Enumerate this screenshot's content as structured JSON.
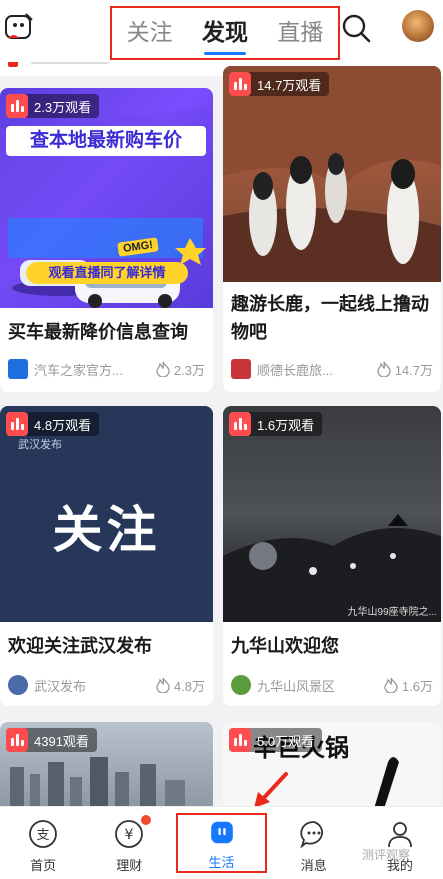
{
  "header": {
    "tabs": [
      {
        "label": "关注",
        "active": false
      },
      {
        "label": "发现",
        "active": true
      },
      {
        "label": "直播",
        "active": false
      }
    ]
  },
  "cards": [
    {
      "views": "2.3万观看",
      "title": "买车最新降价信息查询",
      "source": "汽车之家官方...",
      "likes": "2.3万",
      "banner_title": "查本地最新购车价",
      "banner_cta": "观看直播同了解详情",
      "banner_badge": "OMG!"
    },
    {
      "views": "14.7万观看",
      "title": "趣游长鹿，一起线上撸动物吧",
      "source": "顺德长鹿旅...",
      "likes": "14.7万"
    },
    {
      "views": "4.8万观看",
      "title": "欢迎关注武汉发布",
      "source": "武汉发布",
      "likes": "4.8万",
      "thumb_text": "关注",
      "thumb_sub": "武汉发布"
    },
    {
      "views": "1.6万观看",
      "title": "九华山欢迎您",
      "source": "九华山风景区",
      "likes": "1.6万",
      "thumb_caption": "九华山99座寺院之..."
    },
    {
      "views": "4391观看"
    },
    {
      "views": "5.0万观看",
      "thumb_brand": "辛巨火锅"
    }
  ],
  "tabbar": [
    {
      "label": "首页",
      "icon": "home-icon",
      "active": false
    },
    {
      "label": "理财",
      "icon": "yuan-icon",
      "active": false,
      "badge": true
    },
    {
      "label": "生活",
      "icon": "life-icon",
      "active": true
    },
    {
      "label": "消息",
      "icon": "message-icon",
      "active": false
    },
    {
      "label": "我的",
      "icon": "profile-icon",
      "active": false
    }
  ],
  "watermark": "测评观察",
  "colors": {
    "accent": "#1677ff",
    "highlight": "#e8291c",
    "badge": "#ff4d4f"
  }
}
